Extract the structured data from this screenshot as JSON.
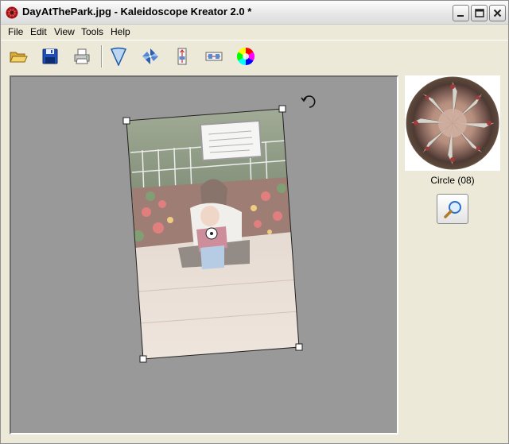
{
  "window": {
    "title": "DayAtThePark.jpg - Kaleidoscope Kreator  2.0 *",
    "controls": [
      "minimize",
      "maximize",
      "close"
    ]
  },
  "menu": {
    "items": [
      "File",
      "Edit",
      "View",
      "Tools",
      "Help"
    ]
  },
  "toolbar": {
    "tools": [
      {
        "icon": "open-folder-icon"
      },
      {
        "icon": "save-disk-icon"
      },
      {
        "icon": "printer-icon"
      },
      {
        "icon": "wedge-icon"
      },
      {
        "icon": "pinwheel-icon"
      },
      {
        "icon": "vertical-mirror-icon"
      },
      {
        "icon": "horizontal-mirror-icon"
      },
      {
        "icon": "color-wheel-icon"
      }
    ]
  },
  "canvas": {
    "background_color": "#999999",
    "source_image_icon": "rotated-photo-with-wedge-overlay",
    "center_handle_icon": "target-circle-icon",
    "rotate_handle_icon": "rotate-arrow-icon"
  },
  "preview": {
    "shape_label": "Circle (08)",
    "zoom_icon": "magnifier-icon"
  }
}
